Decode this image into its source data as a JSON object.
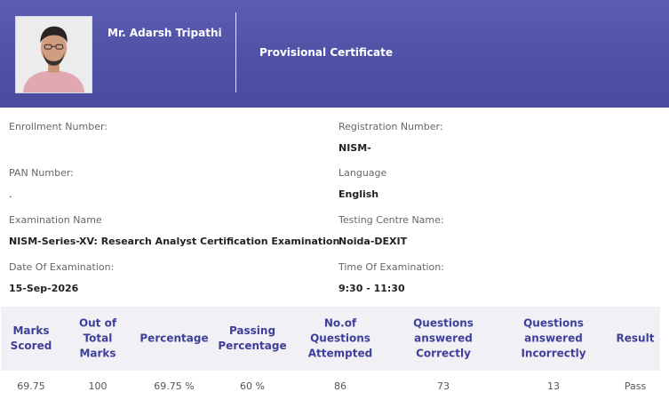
{
  "header": {
    "candidate_name": "Mr. Adarsh Tripathi",
    "certificate_title": "Provisional Certificate"
  },
  "details": {
    "enrollment": {
      "label": "Enrollment Number:",
      "value": ""
    },
    "registration": {
      "label": "Registration Number:",
      "value": "NISM-"
    },
    "pan": {
      "label": "PAN Number:",
      "value": "."
    },
    "language": {
      "label": "Language",
      "value": "English"
    },
    "exam_name": {
      "label": "Examination Name",
      "value": "NISM-Series-XV: Research Analyst Certification Examination"
    },
    "testing_centre": {
      "label": "Testing Centre Name:",
      "value": "Noida-DEXIT"
    },
    "exam_date": {
      "label": "Date Of Examination:",
      "value": "15-Sep-2026"
    },
    "exam_time": {
      "label": "Time Of Examination:",
      "value": "9:30 - 11:30"
    }
  },
  "results": {
    "headers": [
      "Marks Scored",
      "Out of Total Marks",
      "Percentage",
      "Passing Percentage",
      "No.of Questions Attempted",
      "Questions answered Correctly",
      "Questions answered Incorrectly",
      "Result"
    ],
    "values": [
      "69.75",
      "100",
      "69.75 %",
      "60 %",
      "86",
      "73",
      "13",
      "Pass"
    ]
  }
}
